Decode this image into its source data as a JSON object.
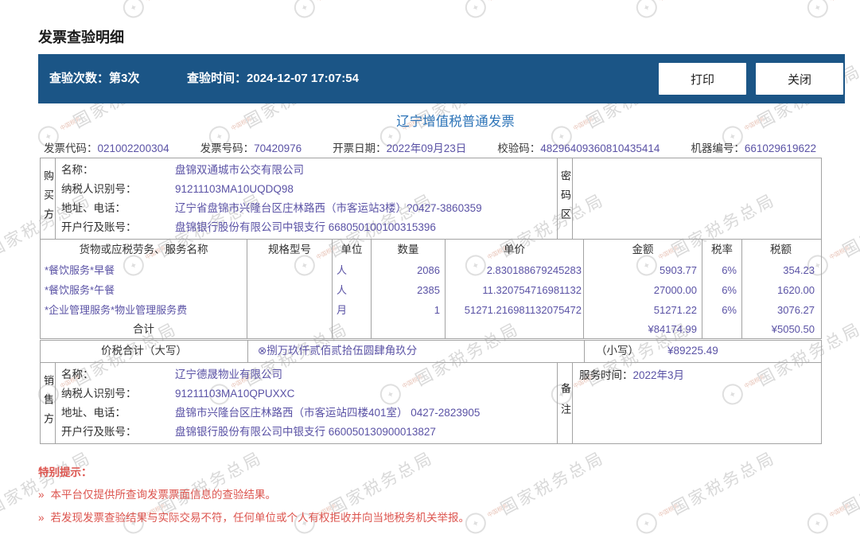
{
  "page": {
    "title": "发票查验明细"
  },
  "toolbar": {
    "check_count_label": "查验次数：",
    "check_count_value": "第3次",
    "check_time_label": "查验时间：",
    "check_time_value": "2024-12-07 17:07:54",
    "print_label": "打印",
    "close_label": "关闭"
  },
  "invoice": {
    "title": "辽宁增值税普通发票",
    "header_fields": [
      {
        "label": "发票代码：",
        "value": "021002200304"
      },
      {
        "label": "发票号码：",
        "value": "70420976"
      },
      {
        "label": "开票日期：",
        "value": "2022年09月23日"
      },
      {
        "label": "校验码：",
        "value": "48296409360810435414"
      },
      {
        "label": "机器编号：",
        "value": "661029619622"
      }
    ],
    "buyer": {
      "side_label": "购买方",
      "rows": [
        {
          "label": "名称：",
          "value": "盘锦双通城市公交有限公司"
        },
        {
          "label": "纳税人识别号：",
          "value": "91211103MA10UQDQ98"
        },
        {
          "label": "地址、电话：",
          "value": "辽宁省盘锦市兴隆台区庄林路西（市客运站3楼）?0427-3860359"
        },
        {
          "label": "开户行及账号：",
          "value": "盘锦银行股份有限公司中银支行 668050100100315396"
        }
      ],
      "password_label": "密码区"
    },
    "items_table": {
      "headers": [
        "货物或应税劳务、服务名称",
        "规格型号",
        "单位",
        "数量",
        "单价",
        "金额",
        "税率",
        "税额"
      ],
      "rows": [
        {
          "name": "*餐饮服务*早餐",
          "spec": "",
          "unit": "人",
          "qty": "2086",
          "price": "2.830188679245283",
          "amount": "5903.77",
          "rate": "6%",
          "tax": "354.23"
        },
        {
          "name": "*餐饮服务*午餐",
          "spec": "",
          "unit": "人",
          "qty": "2385",
          "price": "11.320754716981132",
          "amount": "27000.00",
          "rate": "6%",
          "tax": "1620.00"
        },
        {
          "name": "*企业管理服务*物业管理服务费",
          "spec": "",
          "unit": "月",
          "qty": "1",
          "price": "51271.216981132075472",
          "amount": "51271.22",
          "rate": "6%",
          "tax": "3076.27"
        }
      ],
      "total": {
        "label": "合计",
        "amount": "¥84174.99",
        "tax": "¥5050.50"
      }
    },
    "sum_row": {
      "label": "价税合计（大写）",
      "uppercase": "⊗捌万玖仟贰佰贰拾伍圆肆角玖分",
      "small_label": "（小写）",
      "small_value": "¥89225.49"
    },
    "seller": {
      "side_label": "销售方",
      "rows": [
        {
          "label": "名称：",
          "value": "辽宁德晟物业有限公司"
        },
        {
          "label": "纳税人识别号：",
          "value": "91211103MA10QPUXXC"
        },
        {
          "label": "地址、电话：",
          "value": "盘锦市兴隆台区庄林路西（市客运站四楼401室） 0427-2823905"
        },
        {
          "label": "开户行及账号：",
          "value": "盘锦银行股份有限公司中银支行 660050130900013827"
        }
      ],
      "remark_label": "备注",
      "remark": {
        "label": "服务时间：",
        "value": "2022年3月"
      }
    }
  },
  "notes": {
    "title": "特别提示：",
    "bullet": "»",
    "items": [
      "本平台仅提供所查询发票票面信息的查验结果。",
      "若发现发票查验结果与实际交易不符，任何单位或个人有权拒收并向当地税务机关举报。"
    ]
  },
  "watermark": {
    "text": "国家税务总局",
    "subtext": "中国税务"
  }
}
